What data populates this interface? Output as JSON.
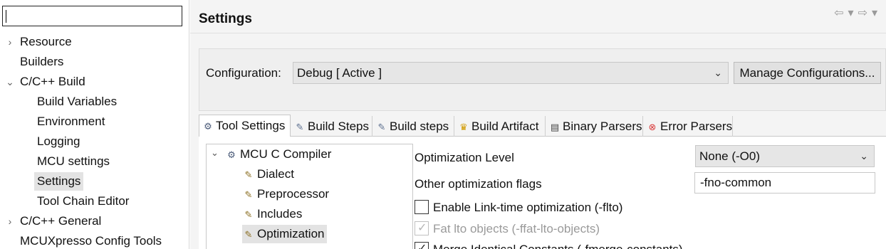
{
  "nav": {
    "filter_value": "",
    "items": [
      {
        "label": "Resource",
        "chevron": "›"
      },
      {
        "label": "Builders"
      },
      {
        "label": "C/C++ Build",
        "chevron": "⌄"
      },
      {
        "label": "Build Variables"
      },
      {
        "label": "Environment"
      },
      {
        "label": "Logging"
      },
      {
        "label": "MCU settings"
      },
      {
        "label": "Settings"
      },
      {
        "label": "Tool Chain Editor"
      },
      {
        "label": "C/C++ General",
        "chevron": "›"
      },
      {
        "label": "MCUXpresso Config Tools"
      }
    ]
  },
  "page": {
    "title": "Settings"
  },
  "config": {
    "label": "Configuration:",
    "value": "Debug  [ Active ]",
    "manage_label": "Manage Configurations..."
  },
  "tabs": [
    {
      "label": "Tool Settings",
      "icon": "tool-settings-icon"
    },
    {
      "label": "Build Steps",
      "icon": "build-steps-icon"
    },
    {
      "label": "Build steps",
      "icon": "build-steps-icon"
    },
    {
      "label": "Build Artifact",
      "icon": "build-artifact-icon"
    },
    {
      "label": "Binary Parsers",
      "icon": "binary-parsers-icon"
    },
    {
      "label": "Error Parsers",
      "icon": "error-parsers-icon"
    }
  ],
  "tree": {
    "root": "MCU C Compiler",
    "items": [
      "Dialect",
      "Preprocessor",
      "Includes",
      "Optimization"
    ]
  },
  "options": {
    "opt_level_label": "Optimization Level",
    "opt_level_value": "None (-O0)",
    "other_flags_label": "Other optimization flags",
    "other_flags_value": "-fno-common",
    "lto_label": "Enable Link-time optimization (-flto)",
    "fat_lto_label": "Fat lto objects (-ffat-lto-objects)",
    "merge_label": "Merge Identical Constants (-fmerge-constants)"
  }
}
